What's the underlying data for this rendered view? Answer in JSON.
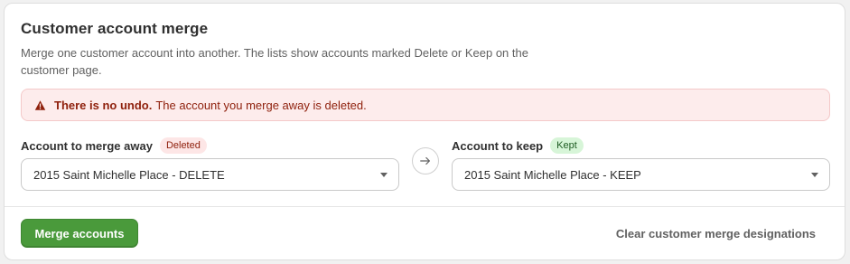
{
  "card": {
    "title": "Customer account merge",
    "description": "Merge one customer account into another. The lists show accounts marked Delete or Keep on the customer page."
  },
  "banner": {
    "strong": "There is no undo.",
    "text": "The account you merge away is deleted.",
    "icon": "warning-triangle-icon",
    "color": "#8e1f0b"
  },
  "merge_away": {
    "label": "Account to merge away",
    "badge": "Deleted",
    "selected": "2015 Saint Michelle Place - DELETE"
  },
  "keep": {
    "label": "Account to keep",
    "badge": "Kept",
    "selected": "2015 Saint Michelle Place - KEEP"
  },
  "actions": {
    "merge_label": "Merge accounts",
    "clear_label": "Clear customer merge designations",
    "merge_color": "#4a9a3b"
  }
}
